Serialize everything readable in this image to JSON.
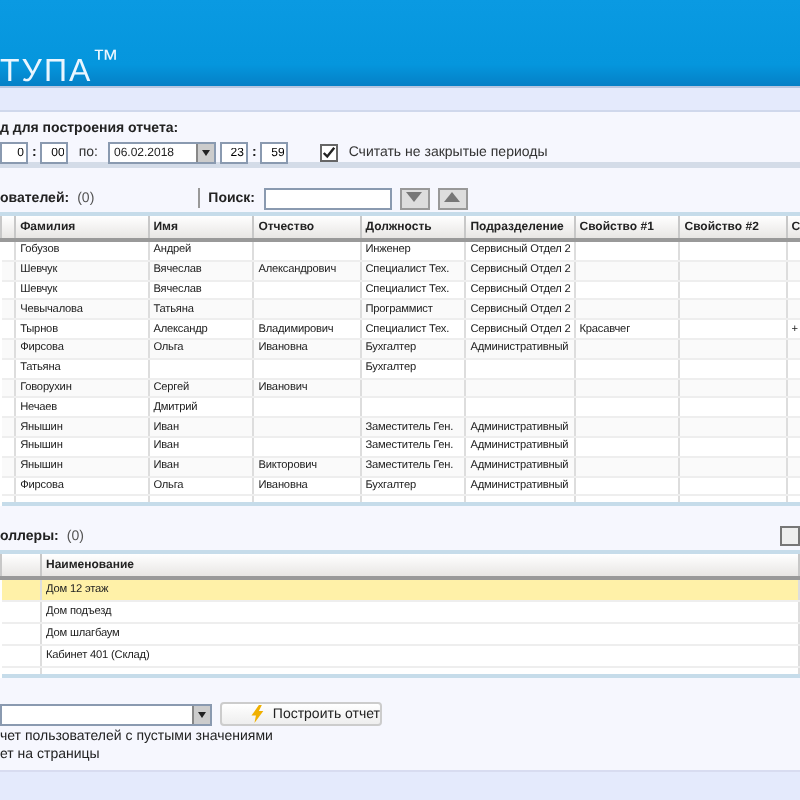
{
  "header": {
    "logo": "ТУПА$^{™}$"
  },
  "period": {
    "title": "д для построения отчета:",
    "from_hour": "0",
    "separator": ":",
    "from_min": "00",
    "to_label": "по:",
    "to_date": "06.02.2018",
    "to_hour": "23",
    "to_min": "59",
    "open_periods": {
      "label": "Считать не закрытые периоды",
      "checked": true
    }
  },
  "users": {
    "title": "ователей:",
    "count": "(0)",
    "search_label": "Поиск:",
    "columns": [
      "",
      "Фамилия",
      "Имя",
      "Отчество",
      "Должность",
      "Подразделение",
      "Свойство #1",
      "Свойство #2",
      "С"
    ],
    "rows": [
      [
        "",
        "Гобузов",
        "Андрей",
        "",
        "Инженер",
        "Сервисный Отдел 2",
        "",
        "",
        ""
      ],
      [
        "",
        "Шевчук",
        "Вячеслав",
        "Александрович",
        "Специалист Тех.",
        "Сервисный Отдел 2",
        "",
        "",
        ""
      ],
      [
        "",
        "Шевчук",
        "Вячеслав",
        "",
        "Специалист Тех.",
        "Сервисный Отдел 2",
        "",
        "",
        ""
      ],
      [
        "",
        "Чевычалова",
        "Татьяна",
        "",
        "Программист",
        "Сервисный Отдел 2",
        "",
        "",
        ""
      ],
      [
        "",
        "Тырнов",
        "Александр",
        "Владимирович",
        "Специалист Тех.",
        "Сервисный Отдел 2",
        "Красавчег",
        "",
        "+"
      ],
      [
        "",
        "Фирсова",
        "Ольга",
        "Ивановна",
        "Бухгалтер",
        "Административный",
        "",
        "",
        ""
      ],
      [
        "",
        "Татьяна",
        "",
        "",
        "Бухгалтер",
        "",
        "",
        "",
        ""
      ],
      [
        "",
        "Говорухин",
        "Сергей",
        "Иванович",
        "",
        "",
        "",
        "",
        ""
      ],
      [
        "",
        "Нечаев",
        "Дмитрий",
        "",
        "",
        "",
        "",
        "",
        ""
      ],
      [
        "",
        "Янышин",
        "Иван",
        "",
        "Заместитель Ген.",
        "Административный",
        "",
        "",
        ""
      ],
      [
        "",
        "Янышин",
        "Иван",
        "",
        "Заместитель Ген.",
        "Административный",
        "",
        "",
        ""
      ],
      [
        "",
        "Янышин",
        "Иван",
        "Викторович",
        "Заместитель Ген.",
        "Административный",
        "",
        "",
        ""
      ],
      [
        "",
        "Фирсова",
        "Ольга",
        "Ивановна",
        "Бухгалтер",
        "Административный",
        "",
        "",
        ""
      ]
    ]
  },
  "controllers": {
    "title": "оллеры:",
    "count": "(0)",
    "columns": [
      "",
      "Наименование"
    ],
    "rows": [
      {
        "name": "Дом 12 этаж",
        "selected": true
      },
      {
        "name": "Дом подъезд",
        "selected": false
      },
      {
        "name": "Дом шлагбаум",
        "selected": false
      },
      {
        "name": "Кабинет 401 (Склад)",
        "selected": false
      }
    ]
  },
  "report": {
    "build_button": "Построить отчет",
    "option_1": "чет пользователей с пустыми значениями",
    "option_2": "ет на страницы"
  }
}
